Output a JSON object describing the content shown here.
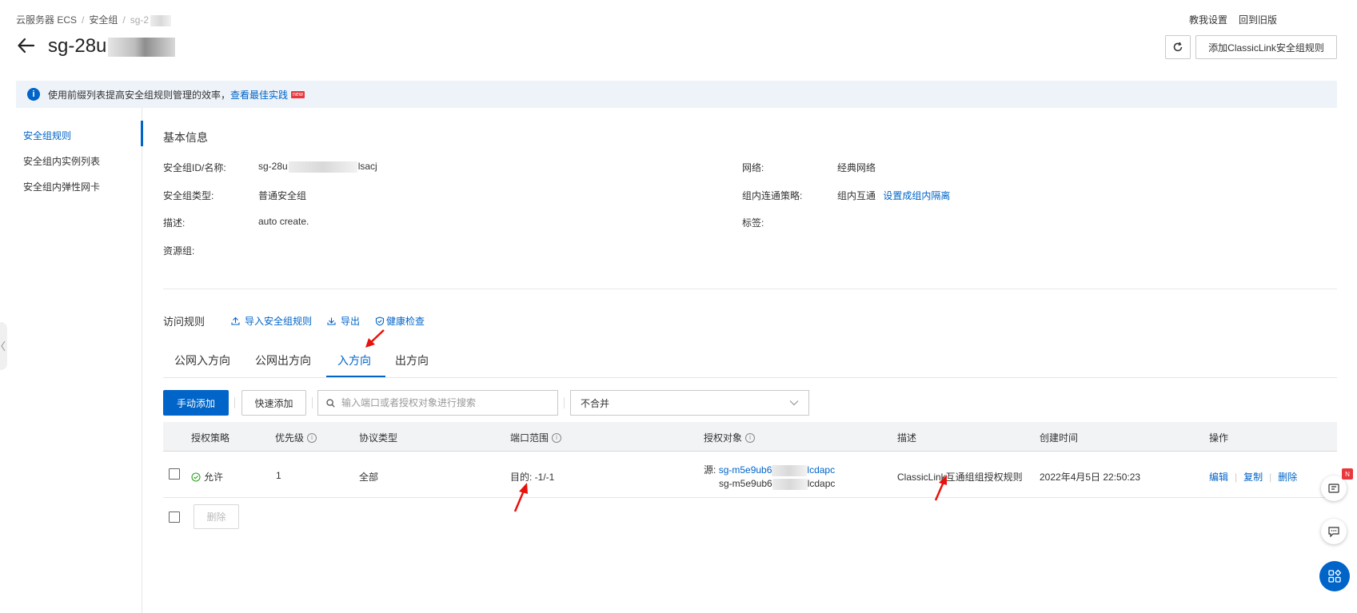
{
  "breadcrumb": {
    "item1": "云服务器 ECS",
    "item2": "安全组",
    "item3": "sg-2"
  },
  "top_links": {
    "tutorial": "教我设置",
    "old_version": "回到旧版"
  },
  "page": {
    "title": "sg-28u"
  },
  "actions": {
    "add_classic_link": "添加ClassicLink安全组规则"
  },
  "notice": {
    "text": "使用前缀列表提高安全组规则管理的效率，",
    "link": "查看最佳实践",
    "badge": "new"
  },
  "sidebar": {
    "items": [
      {
        "label": "安全组规则"
      },
      {
        "label": "安全组内实例列表"
      },
      {
        "label": "安全组内弹性网卡"
      }
    ]
  },
  "basic_info": {
    "title": "基本信息",
    "id_label": "安全组ID/名称:",
    "id_prefix": "sg-28u",
    "id_suffix": "lsacj",
    "type_label": "安全组类型:",
    "type_value": "普通安全组",
    "desc_label": "描述:",
    "desc_value": "auto create.",
    "rg_label": "资源组:",
    "network_label": "网络:",
    "network_value": "经典网络",
    "policy_label": "组内连通策略:",
    "policy_value": "组内互通",
    "policy_link": "设置成组内隔离",
    "tag_label": "标签:"
  },
  "rules": {
    "title": "访问规则",
    "import": "导入安全组规则",
    "export": "导出",
    "health": "健康检查",
    "tabs": [
      {
        "label": "公网入方向"
      },
      {
        "label": "公网出方向"
      },
      {
        "label": "入方向"
      },
      {
        "label": "出方向"
      }
    ],
    "add_manual": "手动添加",
    "add_quick": "快速添加",
    "search_placeholder": "输入端口或者授权对象进行搜索",
    "merge_value": "不合并",
    "delete": "删除"
  },
  "table": {
    "columns": {
      "policy": "授权策略",
      "priority": "优先级",
      "protocol": "协议类型",
      "port": "端口范围",
      "target": "授权对象",
      "desc": "描述",
      "created": "创建时间",
      "ops": "操作"
    },
    "rows": [
      {
        "policy": "允许",
        "priority": "1",
        "protocol": "全部",
        "port": "目的: -1/-1",
        "target_label": "源:",
        "target_link_prefix": "sg-m5e9ub6",
        "target_link_suffix": "lcdapc",
        "target_sub_prefix": "sg-m5e9ub6",
        "target_sub_suffix": "lcdapc",
        "desc": "ClassicLink互通组组授权规则",
        "created": "2022年4月5日 22:50:23",
        "edit": "编辑",
        "copy": "复制",
        "remove": "删除"
      }
    ]
  },
  "colors": {
    "primary": "#0064c8",
    "allow": "#2ea121",
    "annotation": "#e8120c"
  }
}
